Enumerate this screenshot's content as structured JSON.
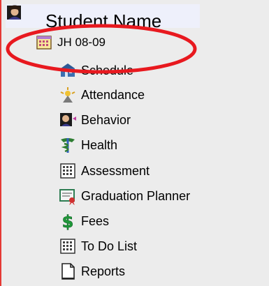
{
  "root": {
    "label": "Student Name",
    "icon": "student-icon"
  },
  "year": {
    "label": "JH 08-09",
    "icon": "calendar-icon"
  },
  "items": [
    {
      "label": "Schedule",
      "icon": "schedule-icon"
    },
    {
      "label": "Attendance",
      "icon": "attendance-icon"
    },
    {
      "label": "Behavior",
      "icon": "behavior-icon"
    },
    {
      "label": "Health",
      "icon": "health-icon"
    },
    {
      "label": "Assessment",
      "icon": "assessment-icon"
    },
    {
      "label": "Graduation Planner",
      "icon": "graduation-planner-icon"
    },
    {
      "label": "Fees",
      "icon": "fees-icon"
    },
    {
      "label": "To Do List",
      "icon": "todo-list-icon"
    },
    {
      "label": "Reports",
      "icon": "reports-icon"
    }
  ],
  "colors": {
    "annotation_ring": "#e8191f",
    "left_border": "#e53935",
    "background": "#ececec",
    "root_highlight": "#eef0fb"
  }
}
